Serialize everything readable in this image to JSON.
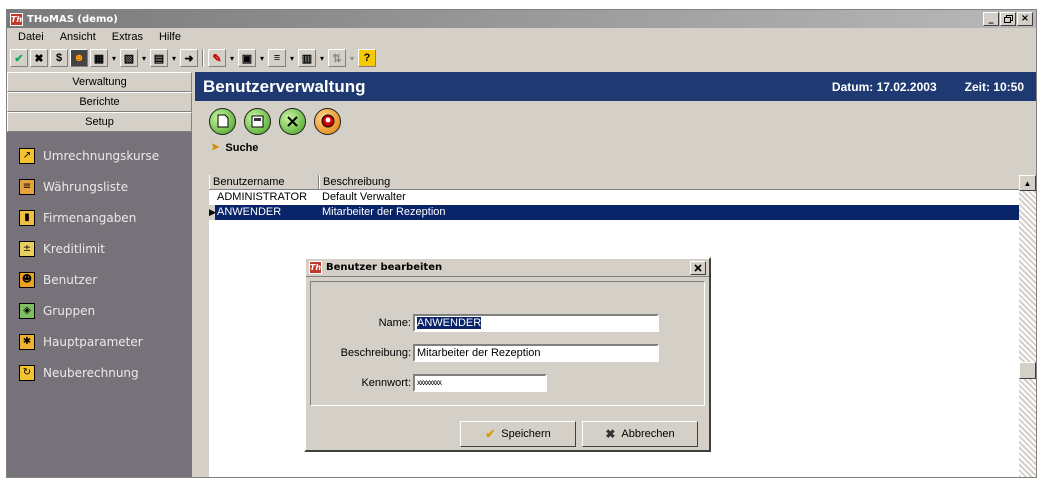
{
  "window": {
    "title": "THoMAS (demo)",
    "app_icon": "thomas-logo-icon",
    "minimize_glyph": "_",
    "restore_glyph": "▫",
    "close_glyph": "×"
  },
  "menu": {
    "items": [
      {
        "label": "Datei"
      },
      {
        "label": "Ansicht"
      },
      {
        "label": "Extras"
      },
      {
        "label": "Hilfe"
      }
    ]
  },
  "sidebar": {
    "tabs": [
      {
        "label": "Verwaltung"
      },
      {
        "label": "Berichte"
      },
      {
        "label": "Setup"
      }
    ],
    "items": [
      {
        "label": "Umrechnungskurse",
        "icon": "chart-icon"
      },
      {
        "label": "Währungsliste",
        "icon": "money-icon"
      },
      {
        "label": "Firmenangaben",
        "icon": "building-icon"
      },
      {
        "label": "Kreditlimit",
        "icon": "limit-icon"
      },
      {
        "label": "Benutzer",
        "icon": "user-icon"
      },
      {
        "label": "Gruppen",
        "icon": "group-icon"
      },
      {
        "label": "Hauptparameter",
        "icon": "settings-icon"
      },
      {
        "label": "Neuberechnung",
        "icon": "recalc-icon"
      }
    ]
  },
  "header": {
    "title": "Benutzerverwaltung",
    "date": "Datum: 17.02.2003",
    "time": "Zeit: 10:50"
  },
  "search": {
    "label": "Suche"
  },
  "table": {
    "columns": [
      "Benutzername",
      "Beschreibung"
    ],
    "rows": [
      {
        "username": "ADMINISTRATOR",
        "description": "Default Verwalter"
      },
      {
        "username": "ANWENDER",
        "description": "Mitarbeiter der Rezeption"
      }
    ]
  },
  "dialog": {
    "title": "Benutzer bearbeiten",
    "name_label": "Name:",
    "name_value": "ANWENDER",
    "description_label": "Beschreibung:",
    "description_value": "Mitarbeiter der Rezeption",
    "password_label": "Kennwort:",
    "password_value": "xxxxxxxx",
    "save_label": "Speichern",
    "cancel_label": "Abbrechen"
  },
  "colors": {
    "header_bg": "#1f3a73",
    "sidebar_bg": "#77727a",
    "selection": "#0a246a"
  }
}
